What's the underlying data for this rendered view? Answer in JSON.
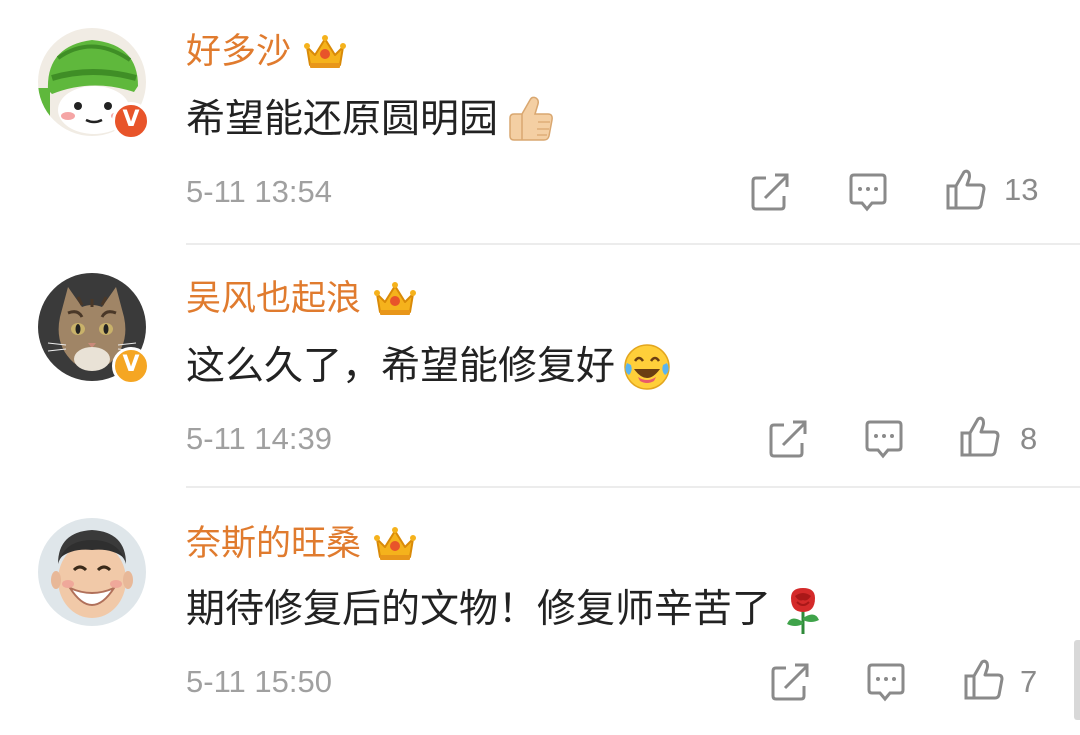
{
  "colors": {
    "username": "#e07b2e",
    "text": "#222222",
    "meta": "#a0a0a0",
    "icon": "#8a8a8a",
    "badge_red": "#e8542a",
    "badge_gold": "#f5a623",
    "divider": "#ececec"
  },
  "comments": [
    {
      "username": "好多沙",
      "badge": "crown-vip-icon",
      "verified": "red-v-badge",
      "text": "希望能还原圆明园",
      "emoji": "thumbs-up-icon",
      "time": "5-11 13:54",
      "likes": "13"
    },
    {
      "username": "吴风也起浪",
      "badge": "crown-vip-icon",
      "verified": "gold-v-badge",
      "text": "这么久了，希望能修复好",
      "emoji": "laugh-cry-icon",
      "time": "5-11 14:39",
      "likes": "8"
    },
    {
      "username": "奈斯的旺桑",
      "badge": "crown-vip-icon",
      "verified": "",
      "text": "期待修复后的文物！修复师辛苦了",
      "emoji": "rose-icon",
      "time": "5-11 15:50",
      "likes": "7"
    }
  ],
  "badges": {
    "v_letter": "V"
  }
}
